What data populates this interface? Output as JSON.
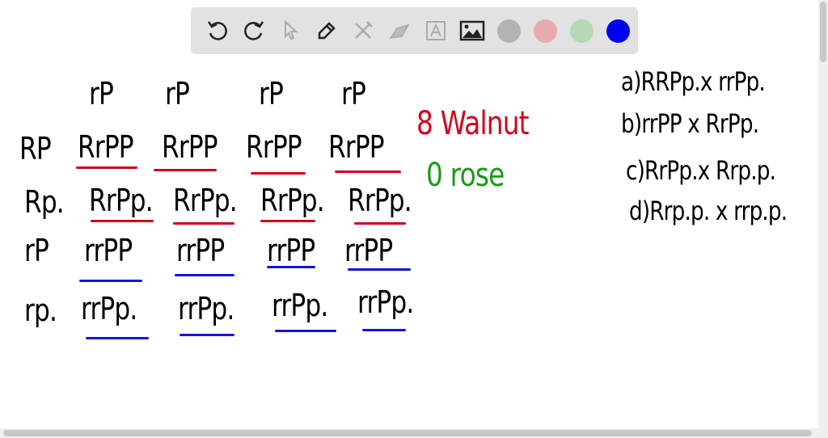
{
  "toolbar": {
    "tools": [
      "undo-icon",
      "redo-icon",
      "select-icon",
      "pen-icon",
      "tools-icon",
      "eraser-icon",
      "text-icon",
      "image-icon"
    ],
    "colors": [
      "#b3b3b3",
      "#e8aab0",
      "#b7d8b7",
      "#0000ee"
    ]
  },
  "board": {
    "col_headers": [
      "rP",
      "rP",
      "rP",
      "rP"
    ],
    "rows": [
      {
        "label": "RP",
        "cells": [
          "RrPP",
          "RrPP",
          "RrPP",
          "RrPP"
        ]
      },
      {
        "label": "Rp.",
        "cells": [
          "RrPp.",
          "RrPp.",
          "RrPp.",
          "RrPp."
        ]
      },
      {
        "label": "rP",
        "cells": [
          "rrPP",
          "rrPP",
          "rrPP",
          "rrPP"
        ]
      },
      {
        "label": "rp.",
        "cells": [
          "rrPp.",
          "rrPp.",
          "rrPp.",
          "rrPp."
        ]
      }
    ],
    "result_walnut": "8 Walnut",
    "result_rose": "0 rose",
    "options": [
      "a)RRPp.x rrPp.",
      "b)rrPP x RrPp.",
      "c)RrPp.x Rrp.p.",
      "d)Rrp.p. x rrp.p."
    ]
  },
  "colors": {
    "red": "#d0021b",
    "green": "#1a9a1a",
    "blue": "#1414d8"
  }
}
